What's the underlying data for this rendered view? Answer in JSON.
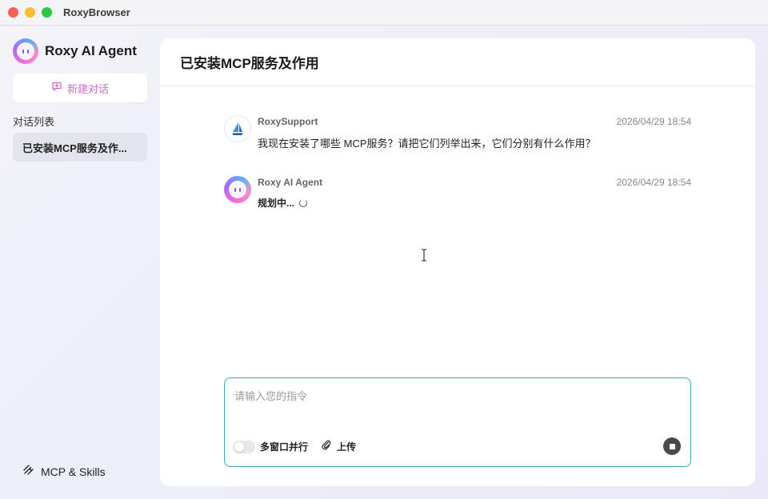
{
  "window": {
    "title": "RoxyBrowser"
  },
  "sidebar": {
    "brand_name": "Roxy AI Agent",
    "new_chat_label": "新建对话",
    "section_label": "对话列表",
    "conversations": [
      {
        "label": "已安装MCP服务及作..."
      }
    ],
    "footer_label": "MCP & Skills"
  },
  "main": {
    "title": "已安装MCP服务及作用",
    "messages": [
      {
        "author": "RoxySupport",
        "time": "2026/04/29 18:54",
        "text": "我现在安装了哪些 MCP服务？请把它们列举出来，它们分别有什么作用？"
      },
      {
        "author": "Roxy AI Agent",
        "time": "2026/04/29 18:54",
        "status": "规划中..."
      }
    ],
    "input": {
      "placeholder": "请输入您的指令",
      "toggle_label": "多窗口并行",
      "upload_label": "上传"
    }
  },
  "colors": {
    "accent_pink": "#d56ad0",
    "input_border": "#39a9b5",
    "traffic_red": "#fe5f57",
    "traffic_yellow": "#febc2e",
    "traffic_green": "#28c840"
  },
  "icons": [
    "new-chat-icon",
    "mcp-icon",
    "sail-logo-icon",
    "paperclip-icon",
    "stop-icon",
    "loading-spinner-icon",
    "text-cursor-icon"
  ]
}
